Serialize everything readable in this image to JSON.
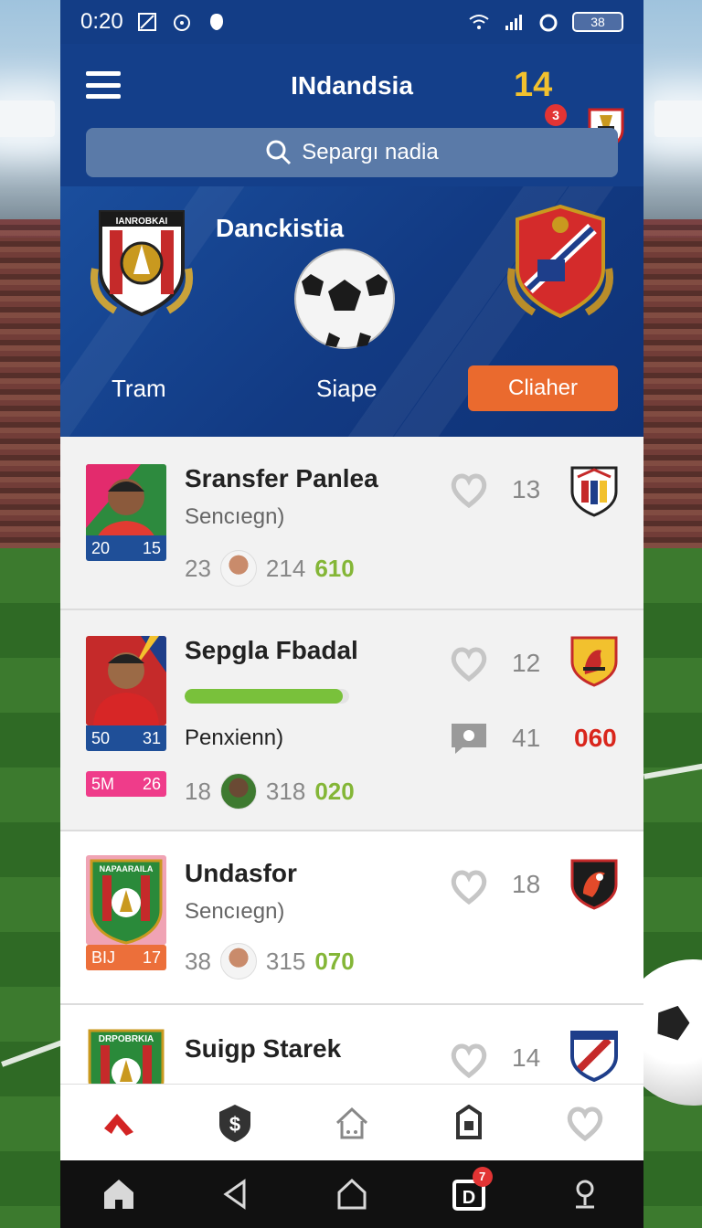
{
  "status_bar": {
    "time": "0:20",
    "battery": "38"
  },
  "header": {
    "title": "INdandsia",
    "coins": "14",
    "coins_badge": "3",
    "search_placeholder": "Separgı nadia"
  },
  "match": {
    "league": "Danckistia",
    "left_label": "Tram",
    "center_label": "Siape",
    "action_button": "Cliaher",
    "left_crest_text": "IANROBKAI"
  },
  "players": [
    {
      "name": "Sransfer Panlea",
      "sub": "Sencıegn)",
      "rating_left": "20",
      "rating_right": "15",
      "stat_a": "23",
      "stat_b": "214",
      "stat_c": "610",
      "likes": "13"
    },
    {
      "name": "Sepgla Fbadal",
      "sub": "Penxienn)",
      "rating_left": "50",
      "rating_right": "31",
      "progress": 0.96,
      "comments": "41",
      "red_value": "060",
      "tag_left": "5M",
      "tag_right": "26",
      "stat_a": "18",
      "stat_b": "318",
      "stat_c": "020",
      "likes": "12"
    },
    {
      "name": "Undasfor",
      "sub": "Sencıegn)",
      "crest_text": "NAPAARAILA",
      "rating_left": "BIJ",
      "rating_right": "17",
      "stat_a": "38",
      "stat_b": "315",
      "stat_c": "070",
      "likes": "18"
    },
    {
      "name": "Suigp Starek",
      "crest_text": "DRPOBRKIA",
      "likes": "14"
    }
  ],
  "colors": {
    "header": "#143f8a",
    "accent": "#ea6a2e",
    "coins": "#f2c12e",
    "rating": "#1f4f98",
    "positive": "#84b637",
    "negative": "#d9261c"
  },
  "bottom_nav": [
    "home-arrow-icon",
    "dollar-shield-icon",
    "house-icon",
    "tag-icon",
    "heart-icon"
  ],
  "system_bar": {
    "notification_badge": "7",
    "d_label": "D"
  }
}
